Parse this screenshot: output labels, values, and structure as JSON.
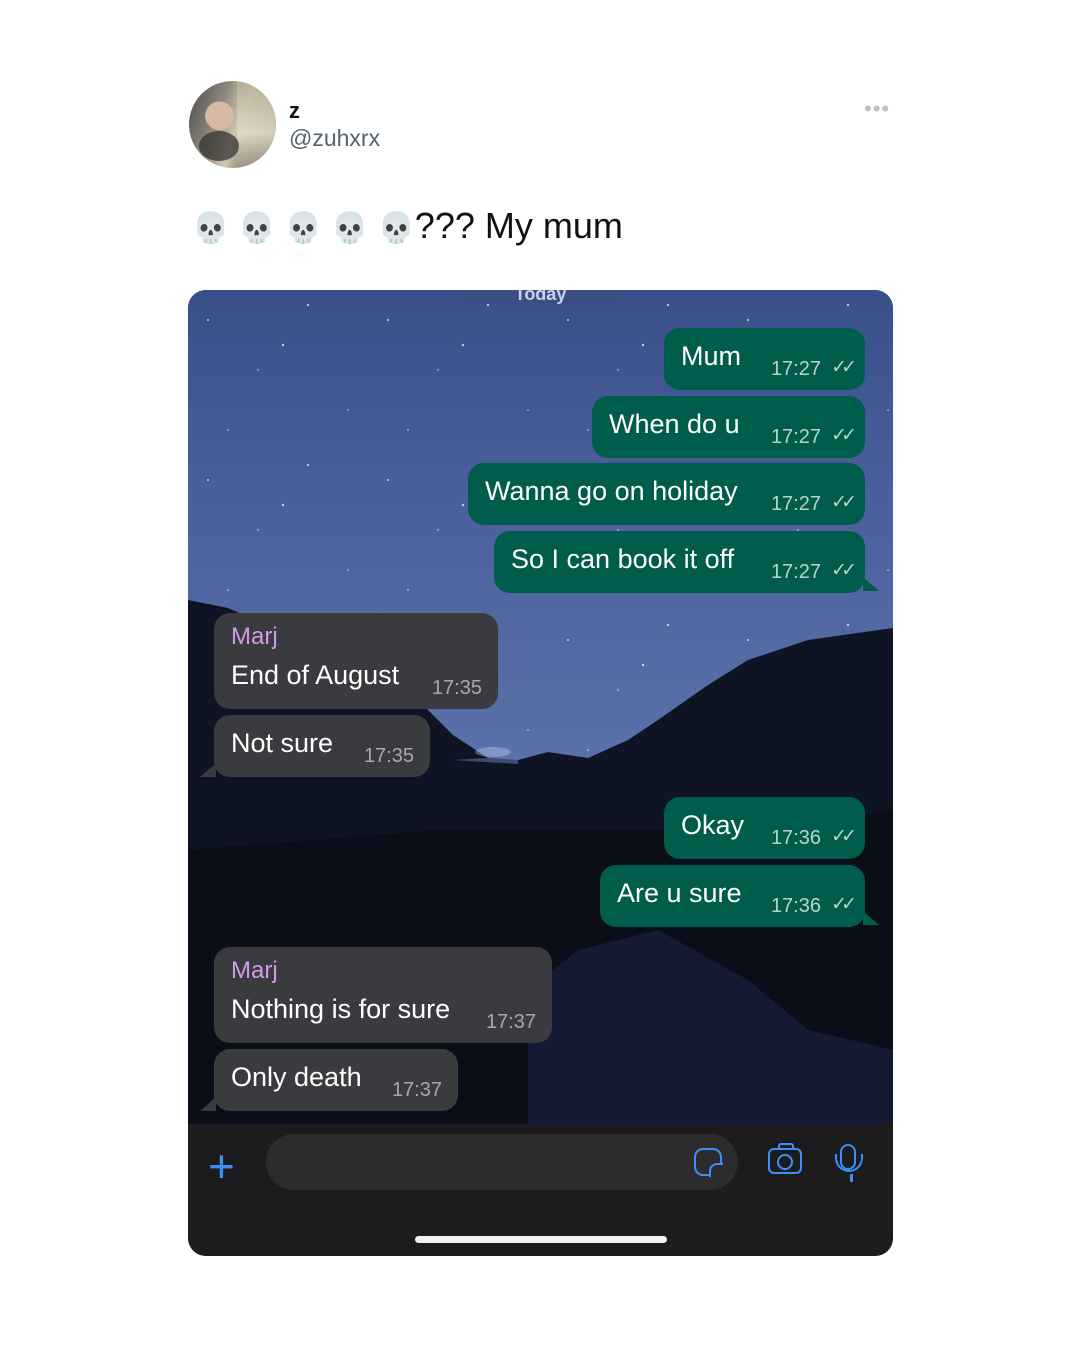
{
  "tweet": {
    "display_name": "z",
    "handle": "@zuhxrx",
    "more_icon": "more-horizontal-icon",
    "emojis": [
      "💀",
      "💀",
      "💀",
      "💀",
      "💀"
    ],
    "text": "??? My mum"
  },
  "chat": {
    "date_label": "Today",
    "tick_glyph": "✓✓",
    "messages": [
      {
        "dir": "out",
        "text": "Mum",
        "time": "17:27"
      },
      {
        "dir": "out",
        "text": "When do u",
        "time": "17:27"
      },
      {
        "dir": "out",
        "text": "Wanna go on holiday",
        "time": "17:27"
      },
      {
        "dir": "out",
        "text": "So I can book it off",
        "time": "17:27"
      },
      {
        "dir": "in",
        "sender": "Marj",
        "text": "End of August",
        "time": "17:35"
      },
      {
        "dir": "in",
        "text": "Not sure",
        "time": "17:35"
      },
      {
        "dir": "out",
        "text": "Okay",
        "time": "17:36"
      },
      {
        "dir": "out",
        "text": "Are u sure",
        "time": "17:36"
      },
      {
        "dir": "in",
        "sender": "Marj",
        "text": "Nothing is for sure",
        "time": "17:37"
      },
      {
        "dir": "in",
        "text": "Only death",
        "time": "17:37"
      }
    ]
  },
  "composer": {
    "placeholder": "",
    "icons": [
      "plus-icon",
      "sticker-icon",
      "camera-icon",
      "microphone-icon"
    ]
  },
  "colors": {
    "outgoing_bubble": "#005c4b",
    "incoming_bubble": "#3a3b3f",
    "sender_name": "#d39ae9",
    "accent": "#3f8ef5"
  }
}
